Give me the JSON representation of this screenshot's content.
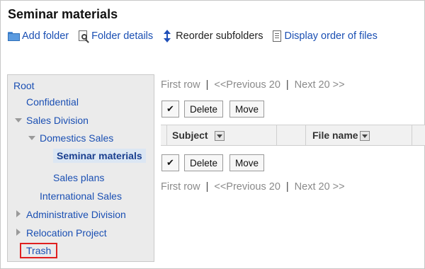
{
  "page": {
    "title": "Seminar materials"
  },
  "toolbar": {
    "add_folder": "Add folder",
    "folder_details": "Folder details",
    "reorder_subfolders": "Reorder subfolders",
    "display_order": "Display order of files"
  },
  "sidebar": {
    "root": "Root",
    "confidential": "Confidential",
    "sales_division": "Sales Division",
    "domestics_sales": "Domestics Sales",
    "seminar_materials": "Seminar materials",
    "sales_plans": "Sales plans",
    "international_sales": "International Sales",
    "administrative_division": "Administrative Division",
    "relocation_project": "Relocation Project",
    "trash": "Trash"
  },
  "pager": {
    "first_row": "First row",
    "separator": "|",
    "previous": "<<Previous 20",
    "next": "Next 20 >>"
  },
  "actions": {
    "check_glyph": "✔",
    "delete_label": "Delete",
    "move_label": "Move"
  },
  "table": {
    "col_subject": "Subject",
    "col_file_name": "File name"
  },
  "colors": {
    "link": "#1a4fb3",
    "disabled": "#8a8a8a",
    "highlight_box": "#e02020",
    "sidebar_bg": "#ebebeb"
  }
}
